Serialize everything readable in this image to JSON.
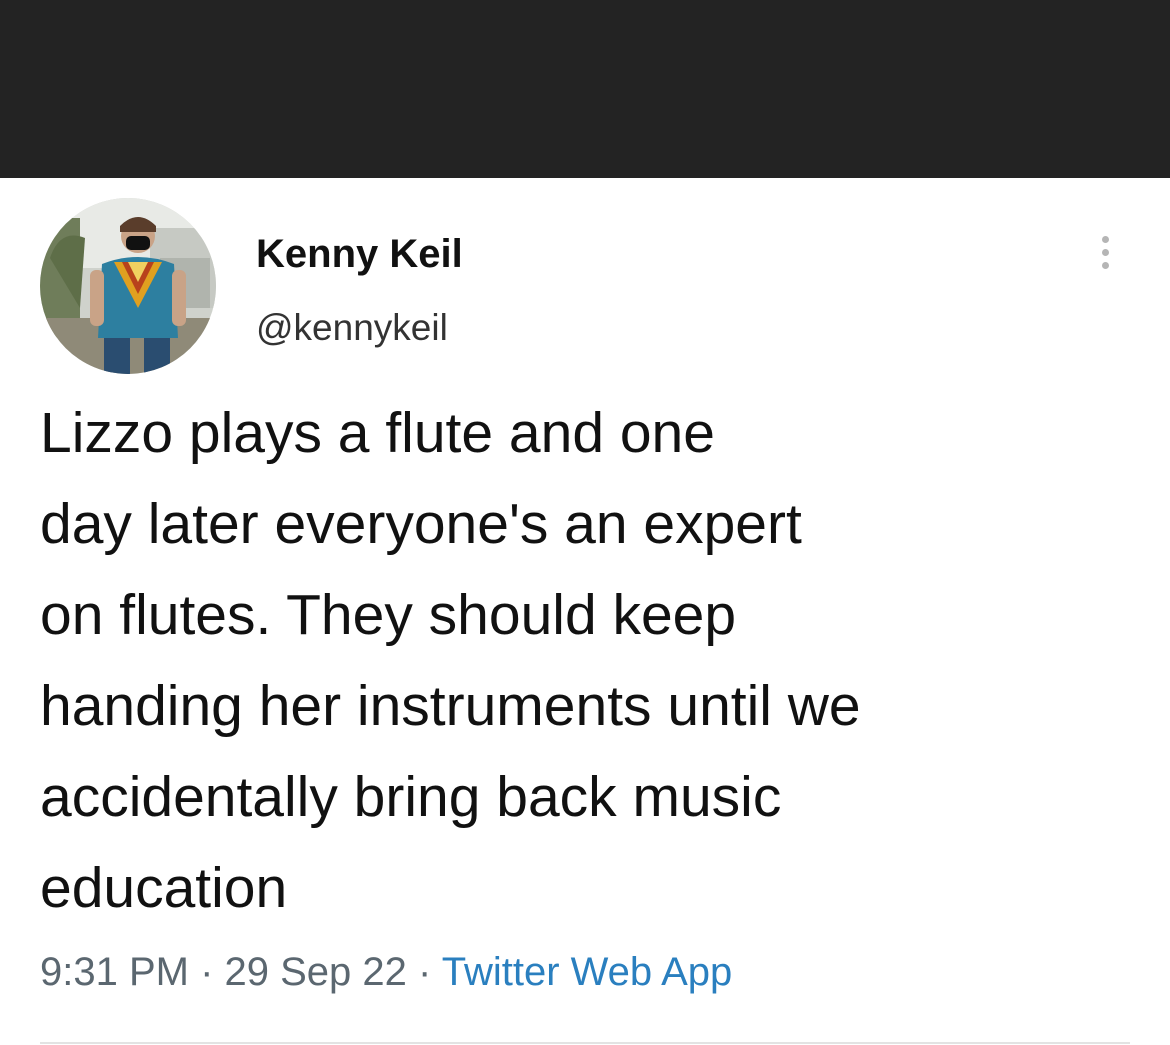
{
  "tweet": {
    "author": {
      "display_name": "Kenny Keil",
      "handle": "@kennykeil",
      "avatar_icon": "user-photo-avatar"
    },
    "more_icon": "vertical-ellipsis-icon",
    "text_lines": [
      "Lizzo plays a flute and one",
      "day later everyone's an expert",
      "on flutes. They should keep",
      "handing her instruments until we",
      "accidentally bring back music",
      "education"
    ],
    "meta": {
      "time": "9:31 PM",
      "separator": " · ",
      "date": "29 Sep 22",
      "source": "Twitter Web App"
    }
  },
  "colors": {
    "top_bar": "#232323",
    "text": "#111111",
    "meta": "#5b6770",
    "link": "#2a7fbf"
  }
}
